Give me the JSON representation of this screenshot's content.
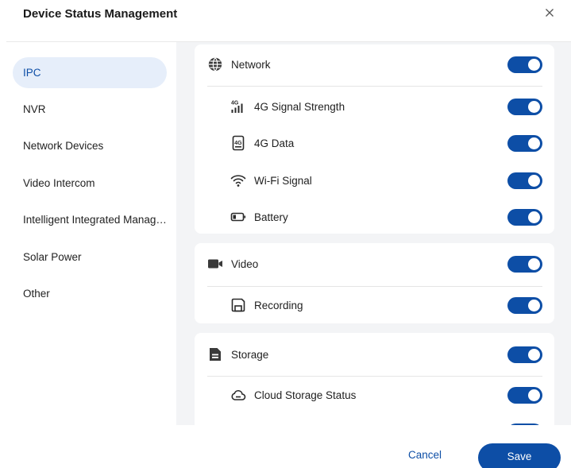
{
  "dialog": {
    "title": "Device Status Management",
    "close_icon": "close-icon"
  },
  "sidebar": {
    "items": [
      {
        "label": "IPC",
        "active": true
      },
      {
        "label": "NVR",
        "active": false
      },
      {
        "label": "Network Devices",
        "active": false
      },
      {
        "label": "Video Intercom",
        "active": false
      },
      {
        "label": "Intelligent Integrated Management",
        "active": false
      },
      {
        "label": "Solar Power",
        "active": false
      },
      {
        "label": "Other",
        "active": false
      }
    ]
  },
  "groups": [
    {
      "label": "Network",
      "icon": "globe-icon",
      "enabled": true,
      "children": [
        {
          "label": "4G Signal Strength",
          "icon": "signal-4g-icon",
          "enabled": true
        },
        {
          "label": "4G Data",
          "icon": "sim-4g-icon",
          "enabled": true
        },
        {
          "label": "Wi-Fi Signal",
          "icon": "wifi-icon",
          "enabled": true
        },
        {
          "label": "Battery",
          "icon": "battery-icon",
          "enabled": true
        }
      ]
    },
    {
      "label": "Video",
      "icon": "video-camera-icon",
      "enabled": true,
      "children": [
        {
          "label": "Recording",
          "icon": "recording-icon",
          "enabled": true
        }
      ]
    },
    {
      "label": "Storage",
      "icon": "storage-icon",
      "enabled": true,
      "children": [
        {
          "label": "Cloud Storage Status",
          "icon": "cloud-icon",
          "enabled": true
        }
      ]
    }
  ],
  "footer": {
    "cancel_label": "Cancel",
    "save_label": "Save"
  },
  "colors": {
    "accent": "#0d4ea6",
    "active_nav_bg": "#e6eefa",
    "content_bg": "#f3f4f6"
  }
}
